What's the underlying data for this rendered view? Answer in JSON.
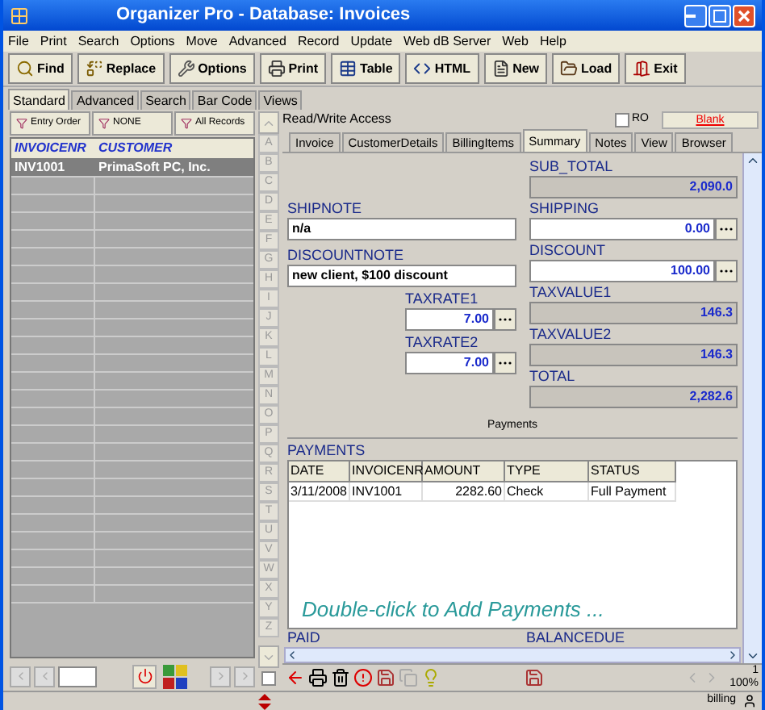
{
  "window": {
    "title": "Organizer Pro - Database: Invoices"
  },
  "menu": [
    "File",
    "Print",
    "Search",
    "Options",
    "Move",
    "Advanced",
    "Record",
    "Update",
    "Web dB Server",
    "Web",
    "Help"
  ],
  "toolbar": [
    {
      "label": "Find",
      "kind": "find"
    },
    {
      "label": "Replace",
      "kind": "replace"
    },
    {
      "label": "Options",
      "kind": "options"
    },
    {
      "label": "Print",
      "kind": "print"
    },
    {
      "label": "Table",
      "kind": "table"
    },
    {
      "label": "HTML",
      "kind": "html"
    },
    {
      "label": "New",
      "kind": "new"
    },
    {
      "label": "Load",
      "kind": "load"
    },
    {
      "label": "Exit",
      "kind": "exit"
    }
  ],
  "view_tabs": [
    {
      "label": "Standard",
      "selected": true
    },
    {
      "label": "Advanced",
      "selected": false
    },
    {
      "label": "Search",
      "selected": false
    },
    {
      "label": "Bar Code",
      "selected": false
    },
    {
      "label": "Views",
      "selected": false
    }
  ],
  "list": {
    "filters": [
      "Entry Order",
      "NONE",
      "All Records"
    ],
    "columns": [
      "INVOICENR",
      "CUSTOMER"
    ],
    "rows": [
      {
        "cells": [
          "INV1001",
          "PrimaSoft PC, Inc."
        ],
        "selected": true
      }
    ]
  },
  "side_checkbox": {
    "checked": false
  },
  "letters": [
    "A",
    "B",
    "C",
    "D",
    "E",
    "F",
    "G",
    "H",
    "I",
    "J",
    "K",
    "L",
    "M",
    "N",
    "O",
    "P",
    "Q",
    "R",
    "S",
    "T",
    "U",
    "V",
    "W",
    "X",
    "Y",
    "Z"
  ],
  "record": {
    "access": "Read/Write Access",
    "ro": {
      "label": "RO",
      "checked": false
    },
    "blank_button": "Blank",
    "tabs": [
      {
        "label": "Invoice",
        "selected": false
      },
      {
        "label": "CustomerDetails",
        "selected": false
      },
      {
        "label": "BillingItems",
        "selected": false
      },
      {
        "label": "Summary",
        "selected": true
      },
      {
        "label": "Notes",
        "selected": false
      },
      {
        "label": "View",
        "selected": false
      },
      {
        "label": "Browser",
        "selected": false
      }
    ],
    "notes": [
      {
        "label": "SHIPNOTE",
        "value": "n/a"
      },
      {
        "label": "DISCOUNTNOTE",
        "value": "new client, $100 discount"
      }
    ],
    "rates": [
      {
        "label": "TAXRATE1",
        "value": "7.00"
      },
      {
        "label": "TAXRATE2",
        "value": "7.00"
      }
    ],
    "totals": [
      {
        "label": "SUB_TOTAL",
        "value": "2,090.0",
        "kind": "readonly"
      },
      {
        "label": "SHIPPING",
        "value": "0.00",
        "kind": "editable"
      },
      {
        "label": "DISCOUNT",
        "value": "100.00",
        "kind": "editable"
      },
      {
        "label": "TAXVALUE1",
        "value": "146.3",
        "kind": "readonly"
      },
      {
        "label": "TAXVALUE2",
        "value": "146.3",
        "kind": "readonly"
      },
      {
        "label": "TOTAL",
        "value": "2,282.6",
        "kind": "readonly"
      }
    ],
    "payments_title": "Payments",
    "payments": {
      "label": "PAYMENTS",
      "columns": [
        "DATE",
        "INVOICENR",
        "AMOUNT",
        "TYPE",
        "STATUS"
      ],
      "rows": [
        [
          "3/11/2008",
          "INV1001",
          "2282.60",
          "Check",
          "Full Payment"
        ]
      ],
      "hint": "Double-click to Add Payments ..."
    },
    "footer_labels": [
      "PAID",
      "BALANCEDUE"
    ]
  },
  "status": {
    "record_number": "1",
    "zoom": "100%",
    "user": "billing"
  }
}
